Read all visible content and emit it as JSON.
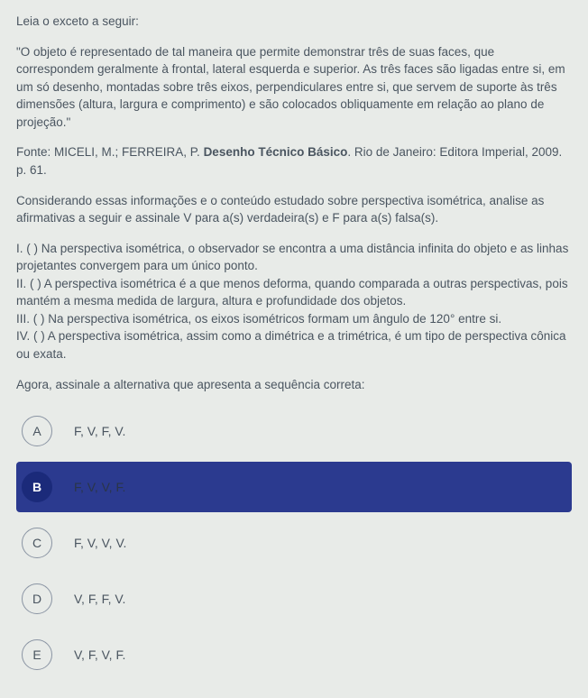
{
  "intro": "Leia o exceto a seguir:",
  "quote": "\"O objeto é representado de tal maneira que permite demonstrar três de suas faces, que correspondem geralmente à frontal, lateral esquerda e superior. As três faces são ligadas entre si, em um só desenho, montadas sobre três eixos, perpendiculares entre si, que servem de suporte às três dimensões (altura, largura e comprimento) e são colocados obliquamente em relação ao plano de projeção.\"",
  "source_prefix": "Fonte: MICELI, M.; FERREIRA, P. ",
  "source_title": "Desenho Técnico Básico",
  "source_suffix": ". Rio de Janeiro: Editora Imperial, 2009. p. 61.",
  "instruction": "Considerando essas informações e o conteúdo estudado sobre perspectiva isométrica, analise as afirmativas a seguir e assinale V para a(s) verdadeira(s) e F para a(s) falsa(s).",
  "statements": {
    "s1": "I. (  ) Na perspectiva isométrica, o observador se encontra a uma distância infinita do objeto e as linhas projetantes convergem para um único ponto.",
    "s2": "II. (  )  A perspectiva isométrica é a que menos deforma, quando comparada a outras perspectivas, pois mantém a mesma medida de largura, altura e profundidade dos objetos.",
    "s3": "III. (  )  Na perspectiva isométrica, os eixos isométricos formam um ângulo de 120° entre si.",
    "s4": "IV. (  )  A perspectiva isométrica, assim como a dimétrica e a trimétrica, é um tipo de perspectiva cônica ou exata."
  },
  "prompt": "Agora, assinale a alternativa que apresenta a sequência correta:",
  "options": {
    "a": {
      "letter": "A",
      "text": "F, V, F, V."
    },
    "b": {
      "letter": "B",
      "text": "F, V, V, F."
    },
    "c": {
      "letter": "C",
      "text": "F, V, V, V."
    },
    "d": {
      "letter": "D",
      "text": "V, F, F, V."
    },
    "e": {
      "letter": "E",
      "text": "V, F, V, F."
    }
  }
}
